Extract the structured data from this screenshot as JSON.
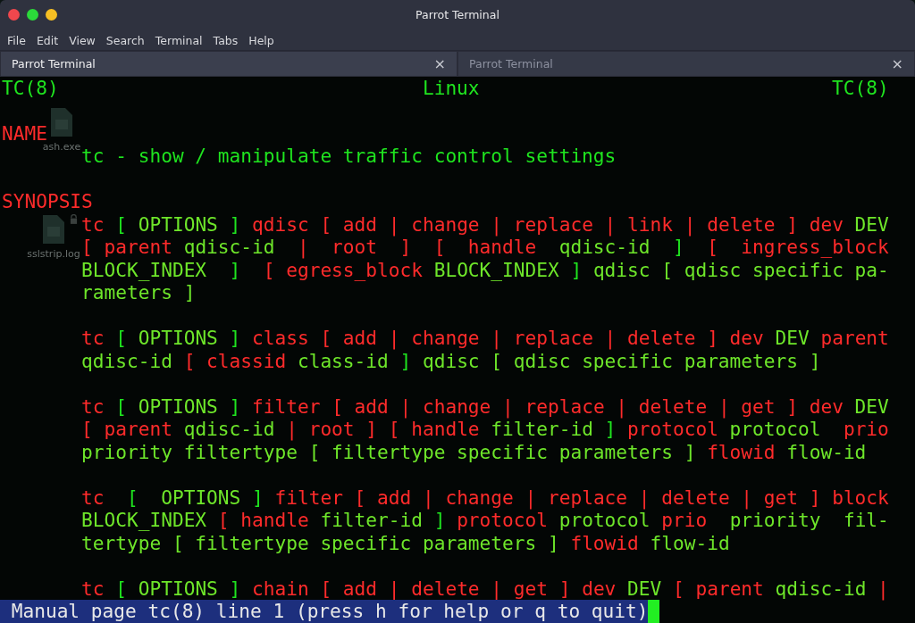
{
  "window": {
    "title": "Parrot Terminal"
  },
  "menu": [
    "File",
    "Edit",
    "View",
    "Search",
    "Terminal",
    "Tabs",
    "Help"
  ],
  "tabs": [
    {
      "label": "Parrot Terminal",
      "selected": true,
      "close": "×"
    },
    {
      "label": "Parrot Terminal",
      "selected": false,
      "close": "×"
    }
  ],
  "desktop_icons": [
    {
      "label": "ash.exe",
      "locked": false
    },
    {
      "label": "sslstrip.log",
      "locked": true
    }
  ],
  "terminal": {
    "lines": [
      {
        "indent": false,
        "gap": false,
        "segments": [
          {
            "kind": "plain",
            "text": "TC(8)                                Linux                               TC(8)"
          }
        ]
      },
      {
        "indent": false,
        "gap": true,
        "segments": [
          {
            "kind": "bold",
            "text": "NAME"
          }
        ]
      },
      {
        "indent": true,
        "gap": false,
        "segments": [
          {
            "kind": "plain",
            "text": "tc - show / manipulate traffic control settings"
          }
        ]
      },
      {
        "indent": false,
        "gap": true,
        "segments": [
          {
            "kind": "bold",
            "text": "SYNOPSIS"
          }
        ]
      },
      {
        "indent": true,
        "gap": false,
        "segments": [
          {
            "kind": "bold",
            "text": "tc"
          },
          {
            "kind": "plain",
            "text": " [ "
          },
          {
            "kind": "arg",
            "text": "OPTIONS"
          },
          {
            "kind": "plain",
            "text": " ] "
          },
          {
            "kind": "bold",
            "text": "qdisc [ add | change | replace | link | delete ] dev"
          },
          {
            "kind": "arg",
            "text": " DEV"
          }
        ]
      },
      {
        "indent": true,
        "gap": false,
        "segments": [
          {
            "kind": "bold",
            "text": "[ parent"
          },
          {
            "kind": "arg",
            "text": " qdisc-id"
          },
          {
            "kind": "bold",
            "text": "  |  root  ]  [  handle"
          },
          {
            "kind": "arg",
            "text": "  qdisc-id"
          },
          {
            "kind": "plain",
            "text": "  ]  "
          },
          {
            "kind": "bold",
            "text": "[  ingress_block"
          }
        ]
      },
      {
        "indent": true,
        "gap": false,
        "segments": [
          {
            "kind": "arg",
            "text": "BLOCK_INDEX"
          },
          {
            "kind": "plain",
            "text": "  ]  "
          },
          {
            "kind": "bold",
            "text": "[ egress_block"
          },
          {
            "kind": "arg",
            "text": " BLOCK_INDEX"
          },
          {
            "kind": "plain",
            "text": " ] "
          },
          {
            "kind": "arg",
            "text": "qdisc [ qdisc specific pa-"
          }
        ]
      },
      {
        "indent": true,
        "gap": false,
        "segments": [
          {
            "kind": "arg",
            "text": "rameters ]"
          }
        ]
      },
      {
        "indent": true,
        "gap": true,
        "segments": [
          {
            "kind": "bold",
            "text": "tc"
          },
          {
            "kind": "plain",
            "text": " [ "
          },
          {
            "kind": "arg",
            "text": "OPTIONS"
          },
          {
            "kind": "plain",
            "text": " ] "
          },
          {
            "kind": "bold",
            "text": "class [ add | change | replace | delete ] dev"
          },
          {
            "kind": "arg",
            "text": " DEV"
          },
          {
            "kind": "bold",
            "text": " parent"
          }
        ]
      },
      {
        "indent": true,
        "gap": false,
        "segments": [
          {
            "kind": "arg",
            "text": "qdisc-id"
          },
          {
            "kind": "bold",
            "text": " [ classid"
          },
          {
            "kind": "arg",
            "text": " class-id"
          },
          {
            "kind": "plain",
            "text": " ] "
          },
          {
            "kind": "arg",
            "text": "qdisc [ qdisc specific parameters ]"
          }
        ]
      },
      {
        "indent": true,
        "gap": true,
        "segments": [
          {
            "kind": "bold",
            "text": "tc"
          },
          {
            "kind": "plain",
            "text": " [ "
          },
          {
            "kind": "arg",
            "text": "OPTIONS"
          },
          {
            "kind": "plain",
            "text": " ] "
          },
          {
            "kind": "bold",
            "text": "filter [ add | change | replace | delete | get ] dev"
          },
          {
            "kind": "arg",
            "text": " DEV"
          }
        ]
      },
      {
        "indent": true,
        "gap": false,
        "segments": [
          {
            "kind": "bold",
            "text": "[ parent"
          },
          {
            "kind": "arg",
            "text": " qdisc-id"
          },
          {
            "kind": "bold",
            "text": " | root ] [ handle"
          },
          {
            "kind": "arg",
            "text": " filter-id"
          },
          {
            "kind": "plain",
            "text": " ] "
          },
          {
            "kind": "bold",
            "text": "protocol"
          },
          {
            "kind": "arg",
            "text": " protocol"
          },
          {
            "kind": "bold",
            "text": "  prio"
          }
        ]
      },
      {
        "indent": true,
        "gap": false,
        "segments": [
          {
            "kind": "arg",
            "text": "priority filtertype [ filtertype specific parameters ]"
          },
          {
            "kind": "bold",
            "text": " flowid"
          },
          {
            "kind": "arg",
            "text": " flow-id"
          }
        ]
      },
      {
        "indent": true,
        "gap": true,
        "segments": [
          {
            "kind": "bold",
            "text": "tc"
          },
          {
            "kind": "plain",
            "text": "  [  "
          },
          {
            "kind": "arg",
            "text": "OPTIONS"
          },
          {
            "kind": "plain",
            "text": " ] "
          },
          {
            "kind": "bold",
            "text": "filter [ add | change | replace | delete | get ] block"
          }
        ]
      },
      {
        "indent": true,
        "gap": false,
        "segments": [
          {
            "kind": "arg",
            "text": "BLOCK_INDEX"
          },
          {
            "kind": "bold",
            "text": " [ handle"
          },
          {
            "kind": "arg",
            "text": " filter-id"
          },
          {
            "kind": "plain",
            "text": " ] "
          },
          {
            "kind": "bold",
            "text": "protocol"
          },
          {
            "kind": "arg",
            "text": " protocol"
          },
          {
            "kind": "bold",
            "text": " prio"
          },
          {
            "kind": "arg",
            "text": "  priority  fil-"
          }
        ]
      },
      {
        "indent": true,
        "gap": false,
        "segments": [
          {
            "kind": "arg",
            "text": "tertype [ filtertype specific parameters ]"
          },
          {
            "kind": "bold",
            "text": " flowid"
          },
          {
            "kind": "arg",
            "text": " flow-id"
          }
        ]
      },
      {
        "indent": true,
        "gap": true,
        "segments": [
          {
            "kind": "bold",
            "text": "tc"
          },
          {
            "kind": "plain",
            "text": " [ "
          },
          {
            "kind": "arg",
            "text": "OPTIONS"
          },
          {
            "kind": "plain",
            "text": " ] "
          },
          {
            "kind": "bold",
            "text": "chain [ add | delete | get ] dev"
          },
          {
            "kind": "arg",
            "text": " DEV"
          },
          {
            "kind": "bold",
            "text": " [ parent"
          },
          {
            "kind": "arg",
            "text": " qdisc-id"
          },
          {
            "kind": "bold",
            "text": " |"
          }
        ]
      }
    ],
    "status_line": "Manual page tc(8) line 1 (press h for help or q to quit)"
  }
}
